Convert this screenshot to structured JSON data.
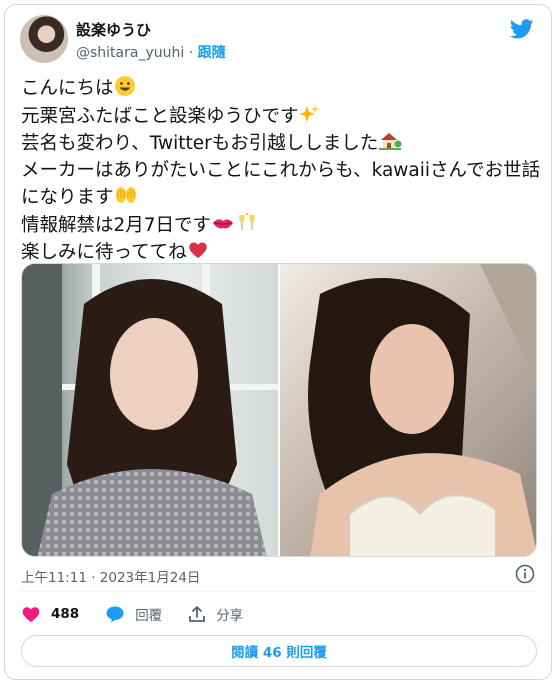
{
  "author": {
    "display_name": "設楽ゆうひ",
    "handle": "@shitara_yuuhi",
    "separator": " · ",
    "follow_label": "跟隨"
  },
  "tweet": {
    "lines": [
      "こんにちは",
      "元栗宮ふたばこと設楽ゆうひです",
      "芸名も変わり、Twitterもお引越ししました",
      "メーカーはありがたいことにこれからも、kawaiiさんでお世話になります",
      "情報解禁は2月7日です",
      "楽しみに待っててね"
    ],
    "emojis": [
      "grinning-face",
      "sparkles",
      "house-with-garden",
      "raising-hands",
      "lips",
      "clinking-glasses",
      "red-heart"
    ]
  },
  "media": {
    "images": [
      "photo-left",
      "photo-right"
    ]
  },
  "timestamp": "上午11:11 · 2023年1月24日",
  "actions": {
    "like_count": "488",
    "reply_label": "回覆",
    "share_label": "分享"
  },
  "read_replies_label": "閱讀 46 則回覆",
  "colors": {
    "accent": "#1d9bf0",
    "like": "#f91880",
    "border": "#cfd9de",
    "secondary_text": "#536471"
  }
}
